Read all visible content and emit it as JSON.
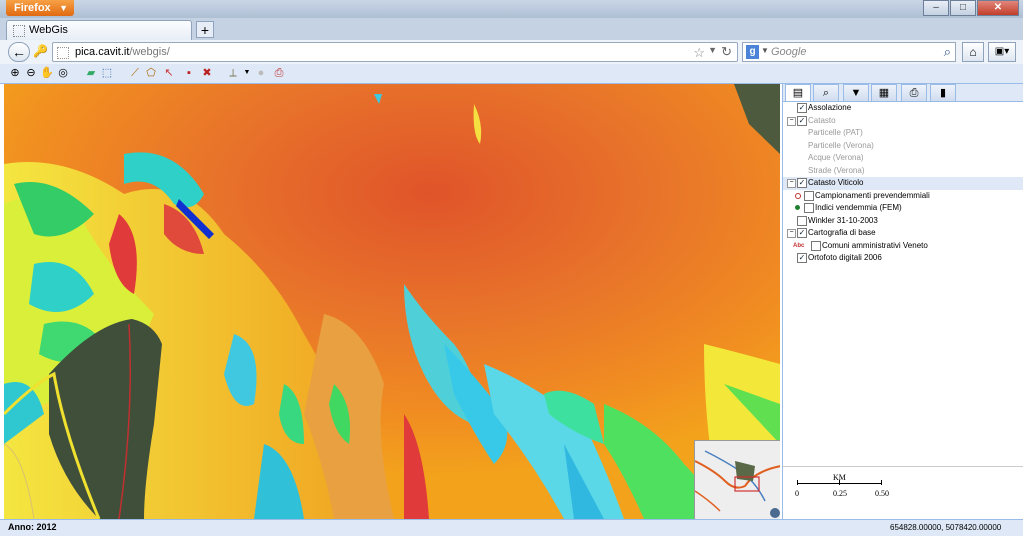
{
  "browser": {
    "menu_label": "Firefox",
    "tab_title": "WebGis",
    "new_tab_symbol": "+",
    "url_host": "pica.cavit.it",
    "url_path": "/webgis/",
    "search_placeholder": "Google",
    "window_buttons": [
      "–",
      "□",
      "✕"
    ]
  },
  "map_toolbar": {
    "tools": [
      "zoom-in-icon",
      "zoom-out-icon",
      "pan-hand-icon",
      "zoom-extent-icon",
      "open-folder-icon",
      "select-box-icon",
      "measure-line-icon",
      "measure-area-icon",
      "pointer-icon",
      "save-icon",
      "delete-icon",
      "ruler-icon",
      "circle-icon",
      "print-icon"
    ]
  },
  "panel": {
    "tabs": [
      "layers-tab-icon",
      "search-tab-icon",
      "filter-tab-icon",
      "table-tab-icon",
      "print-tab-icon",
      "chart-tab-icon"
    ],
    "layers": {
      "assolazione": "Assolazione",
      "catasto": "Catasto",
      "particelle_pat": "Particelle (PAT)",
      "particelle_verona": "Particelle (Verona)",
      "acque_verona": "Acque (Verona)",
      "strade_verona": "Strade (Verona)",
      "catasto_viticolo": "Catasto Viticolo",
      "campionamenti": "Campionamenti prevendemmiali",
      "indici": "Indici vendemmia (FEM)",
      "winkler": "Winkler 31-10-2003",
      "cartografia": "Cartografia di base",
      "comuni": "Comuni amministrativi Veneto",
      "comuni_prefix": "Abc",
      "ortofoto": "Ortofoto digitali 2006"
    },
    "scale": {
      "unit": "KM",
      "labels": [
        "0",
        "0.25",
        "0.50"
      ]
    }
  },
  "status": {
    "year": "Anno: 2012",
    "coordinates": "654828.00000, 5078420.00000"
  },
  "colors": {
    "accent": "#dfe8f6",
    "border": "#99bbe8",
    "firefox_orange": "#e87a1e"
  }
}
